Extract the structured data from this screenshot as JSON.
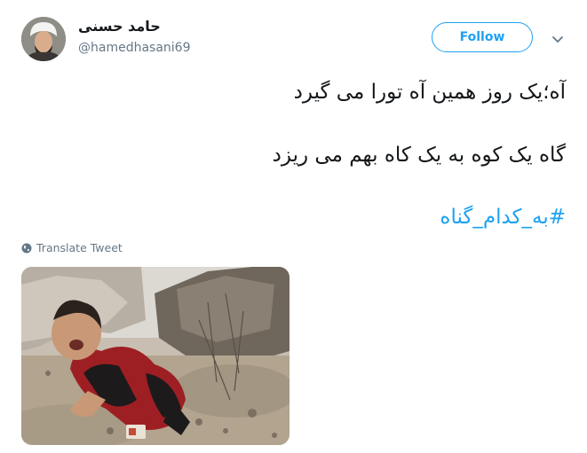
{
  "author": {
    "display_name": "حامد حسنی",
    "handle": "@hamedhasani69",
    "avatar_icon": "user-avatar"
  },
  "follow_button": {
    "label": "Follow",
    "color": "#1da1f2"
  },
  "menu": {
    "icon": "chevron-down-icon"
  },
  "tweet": {
    "lines": [
      "آه؛یک روز همین آه تورا می گیرد",
      "گاه یک کوه به یک کاه بهم می ریزد"
    ],
    "hashtag": "#به_کدام_گناه"
  },
  "translate": {
    "label": "Translate Tweet",
    "icon": "globe-icon"
  },
  "media": {
    "description_icon": "photo-crying-child"
  },
  "colors": {
    "link": "#1da1f2",
    "muted": "#657786",
    "text": "#14171a"
  }
}
